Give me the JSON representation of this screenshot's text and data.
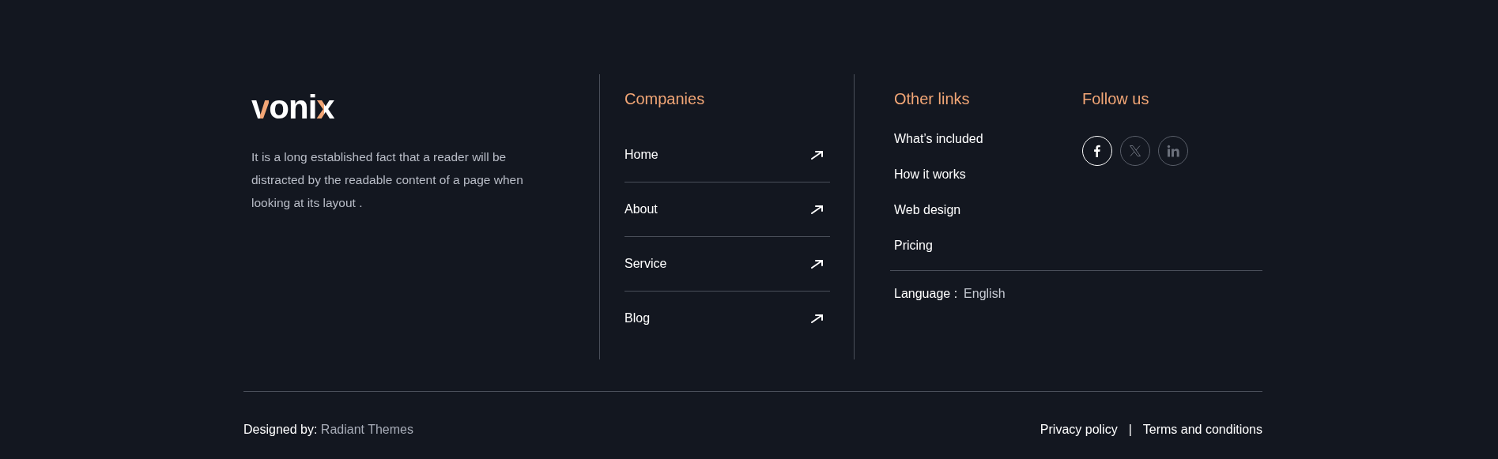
{
  "brand": {
    "logo": "vonix",
    "description": "It is a long established fact that a reader will be distracted by the readable content of a page when looking at its layout ."
  },
  "companies": {
    "heading": "Companies",
    "links": [
      {
        "label": "Home"
      },
      {
        "label": "About"
      },
      {
        "label": "Service"
      },
      {
        "label": "Blog"
      }
    ]
  },
  "other_links": {
    "heading": "Other links",
    "links": [
      "What’s included",
      "How it works",
      "Web design",
      "Pricing"
    ]
  },
  "follow_us": {
    "heading": "Follow us",
    "socials": [
      {
        "kind": "facebook",
        "selected": true
      },
      {
        "kind": "x",
        "selected": false
      },
      {
        "kind": "linkedin",
        "selected": false
      }
    ]
  },
  "language": {
    "label": "Language :",
    "value": "English"
  },
  "bottom": {
    "credit_label": "Designed by:",
    "credit_link": "Radiant Themes",
    "links": [
      "Privacy policy",
      "Terms and conditions"
    ],
    "separator": "|"
  }
}
